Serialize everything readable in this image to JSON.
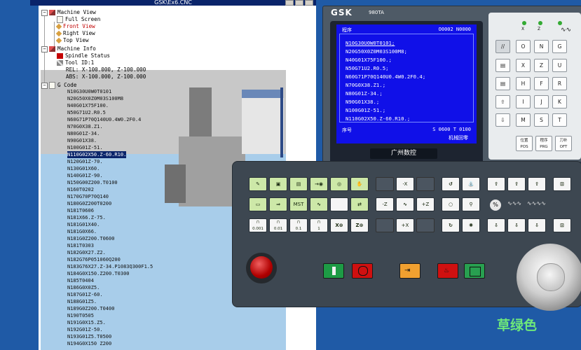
{
  "window": {
    "title": "GSK\\Ex6.CNC"
  },
  "tree": {
    "machine_view": "Machine View",
    "full_screen": "Full Screen",
    "front_view": "Front View",
    "right_view": "Right View",
    "top_view": "Top View",
    "machine_info": "Machine Info",
    "spindle_status": "Spindle Status",
    "tool_id": "Tool ID:1",
    "rel": "REL: X-100.000, Z-100.000",
    "abs": "ABS: X-100.000, Z-100.000",
    "g_code": "G Code"
  },
  "gcode_lines": [
    "N10G30U0W0T0101",
    "N20G50X0Z0M03S100M8",
    "N40G01X75F100.",
    "N50G71U2.R0.5",
    "N60G71P70Q140U0.4W0.2F0.4",
    "N70G0X38.Z1.",
    "N80G01Z-34.",
    "N90G01X38.",
    "N100G01Z-51.",
    "N110G02X50.Z-60.R10.",
    "N120G01Z-70.",
    "N130G01X60.",
    "N140G01Z-90.",
    "N150G00Z200.T0100",
    "N160T0202",
    "N170G70P70Q140",
    "N180G0Z200T0200",
    "N181T0606",
    "N181X66.Z-75.",
    "N181G01X40.",
    "N181G0X66.",
    "N181G0Z200.T0600",
    "N181T0303",
    "N182G0X27.Z2.",
    "N182G76P051060Q200",
    "N183G76X27.Z-34.P1083Q300F1.5",
    "N184G0X150.Z200.T0300",
    "N185T0404",
    "N186G0X0Z5.",
    "N187G01Z-60.",
    "N188G01Z5.",
    "N189G0Z200.T0400",
    "N190T0505",
    "N191G0X15.Z5.",
    "N192G01Z-50.",
    "N193G01Z5.T0500",
    "N194G0X150 Z200"
  ],
  "gcode_highlight_index": 9,
  "cnc": {
    "brand": "GSK",
    "model": "980TA",
    "screen": {
      "label": "程序",
      "program": "O0002 N0000",
      "lines": [
        "N10G30U0W0T0101;",
        "N20G50X0Z0M03S100M8;",
        "N40G01X75F100.;",
        "N50G71U2.R0.5;",
        "N60G71P70Q140U0.4W0.2F0.4;",
        "N70G0X38.Z1.;",
        "N80G01Z-34.;",
        "N90G01X38.;",
        "N100G01Z-51.;",
        "N110G02X50.Z-60.R10.;"
      ],
      "seq_label": "序号",
      "status": "S 0600  T 0100",
      "mode": "机械回零"
    },
    "bezel_logo": "广州数控"
  },
  "keypad": {
    "top_row": [
      "X",
      "Z",
      "U"
    ],
    "rows": [
      [
        "//",
        "O",
        "N",
        "G"
      ],
      [
        "X",
        "Z",
        "U"
      ],
      [
        "H",
        "F",
        "R"
      ],
      [
        "I",
        "J",
        "K"
      ],
      [
        "M",
        "S",
        "T"
      ]
    ],
    "bottom": [
      "位置\nPOS",
      "程序\nPRG",
      "刀补\nOFT"
    ]
  },
  "operator_panel": {
    "jog_minus_x": "-X",
    "jog_minus_z": "-Z",
    "jog_plus_z": "+Z",
    "jog_plus_x": "+X",
    "mst_label": "MST",
    "step_labels": [
      "0.001",
      "0.01",
      "0.1",
      "1"
    ],
    "percent": "%"
  },
  "caption": "草绿色",
  "colors": {
    "screen_bg": "#1010e8",
    "panel_bg": "#3d4751",
    "key_green": "#cde8a8",
    "start_green": "#1d9b45",
    "stop_red": "#d01010",
    "caption_green": "#6ee87a"
  }
}
